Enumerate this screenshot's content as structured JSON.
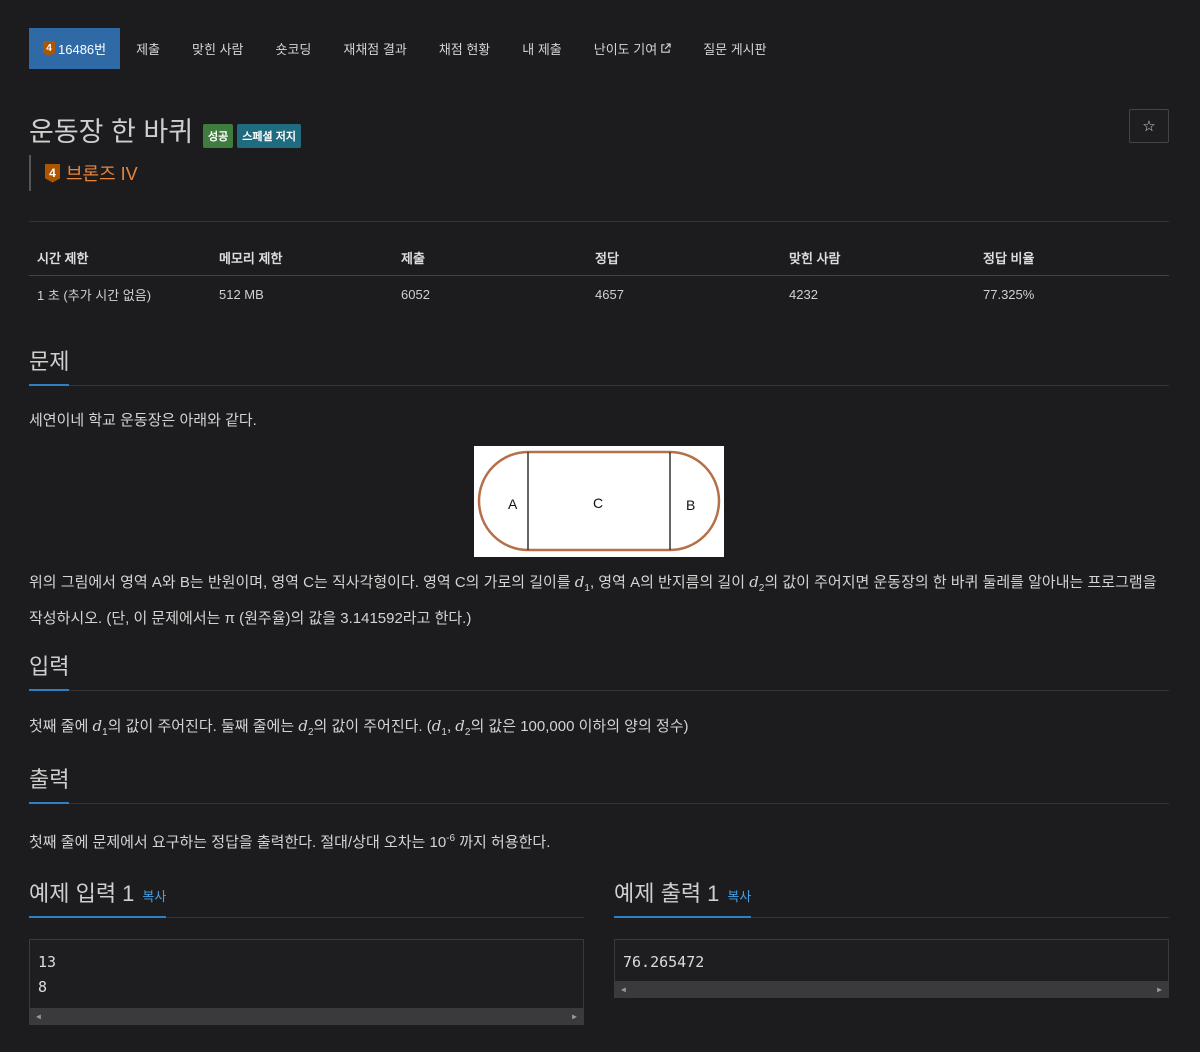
{
  "tabs": {
    "problem_tier": "4",
    "problem_number": "16486번",
    "items": [
      "제출",
      "맞힌 사람",
      "숏코딩",
      "재채점 결과",
      "채점 현황",
      "내 제출",
      "난이도 기여",
      "질문 게시판"
    ]
  },
  "title": {
    "text": "운동장 한 바퀴",
    "badge_success": "성공",
    "badge_special": "스페셜 저지",
    "star": "☆",
    "tier_digit": "4",
    "tier_name": "브론즈 IV"
  },
  "stats": {
    "headers": [
      "시간 제한",
      "메모리 제한",
      "제출",
      "정답",
      "맞힌 사람",
      "정답 비율"
    ],
    "values": [
      "1 초 (추가 시간 없음)",
      "512 MB",
      "6052",
      "4657",
      "4232",
      "77.325%"
    ]
  },
  "sections": {
    "problem": "문제",
    "input": "입력",
    "output": "출력",
    "sample_input": "예제 입력 1",
    "sample_output": "예제 출력 1",
    "copy": "복사"
  },
  "problem": {
    "intro": "세연이네 학교 운동장은 아래와 같다.",
    "figure_labels": [
      "A",
      "C",
      "B"
    ],
    "desc_a": "위의 그림에서 영역 A와 B는 반원이며, 영역 C는 직사각형이다. 영역 C의 가로의 길이를 ",
    "desc_b": ", 영역 A의 반지름의 길이 ",
    "desc_c": "의 값이 주어지면 운동장의 한 바퀴 둘레를 알아내는 프로그램을 작성하시오. (단, 이 문제에서는 π (원주율)의 값을 3.141592라고 한다.)"
  },
  "input": {
    "a": "첫째 줄에 ",
    "b": "의 값이 주어진다. 둘째 줄에는 ",
    "c": "의 값이 주어진다. (",
    "d": ", ",
    "e": "의 값은 100,000 이하의 양의 정수)"
  },
  "output": {
    "a": "첫째 줄에 문제에서 요구하는 정답을 출력한다. 절대/상대 오차는 10",
    "exp": "-6",
    "b": " 까지 허용한다."
  },
  "vars": {
    "d": "d",
    "one": "1",
    "two": "2"
  },
  "samples": {
    "input": "13\n8",
    "output": "76.265472"
  },
  "colors": {
    "accent": "#2f6aa7",
    "bronze": "#ad5600",
    "success": "#3f7d3f",
    "special": "#1f6c80"
  }
}
